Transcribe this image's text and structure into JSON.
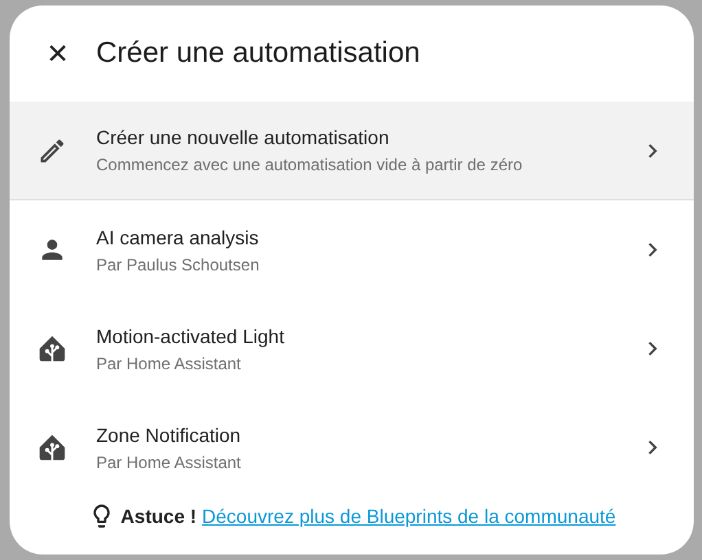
{
  "dialog": {
    "title": "Créer une automatisation",
    "close_icon": "✕"
  },
  "items": [
    {
      "kind": "new",
      "title": "Créer une nouvelle automatisation",
      "subtitle": "Commencez avec une automatisation vide à partir de zéro",
      "selected": true
    },
    {
      "kind": "user_blueprint",
      "title": "AI camera analysis",
      "subtitle": "Par Paulus Schoutsen",
      "selected": false
    },
    {
      "kind": "official_blueprint",
      "title": "Motion-activated Light",
      "subtitle": "Par Home Assistant",
      "selected": false
    },
    {
      "kind": "official_blueprint",
      "title": "Zone Notification",
      "subtitle": "Par Home Assistant",
      "selected": false
    }
  ],
  "tip": {
    "label": "Astuce !",
    "link": "Découvrez plus de Blueprints de la communauté"
  }
}
